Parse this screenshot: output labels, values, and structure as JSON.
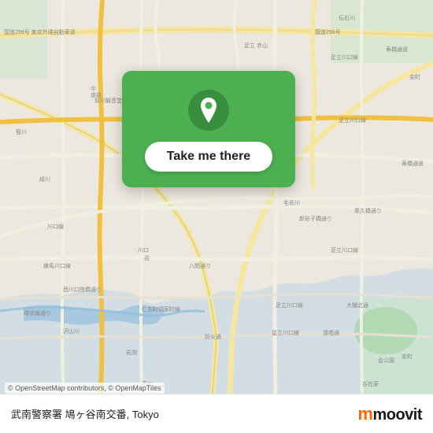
{
  "map": {
    "background_color": "#e8dfd0",
    "location_name": "武南警察署 鳩ヶ谷南交番",
    "city": "Tokyo"
  },
  "card": {
    "button_label": "Take me there"
  },
  "attribution": {
    "text": "© OpenStreetMap contributors, © OpenMapTiles"
  },
  "moovit": {
    "label": "moovit"
  },
  "icons": {
    "pin": "📍"
  }
}
